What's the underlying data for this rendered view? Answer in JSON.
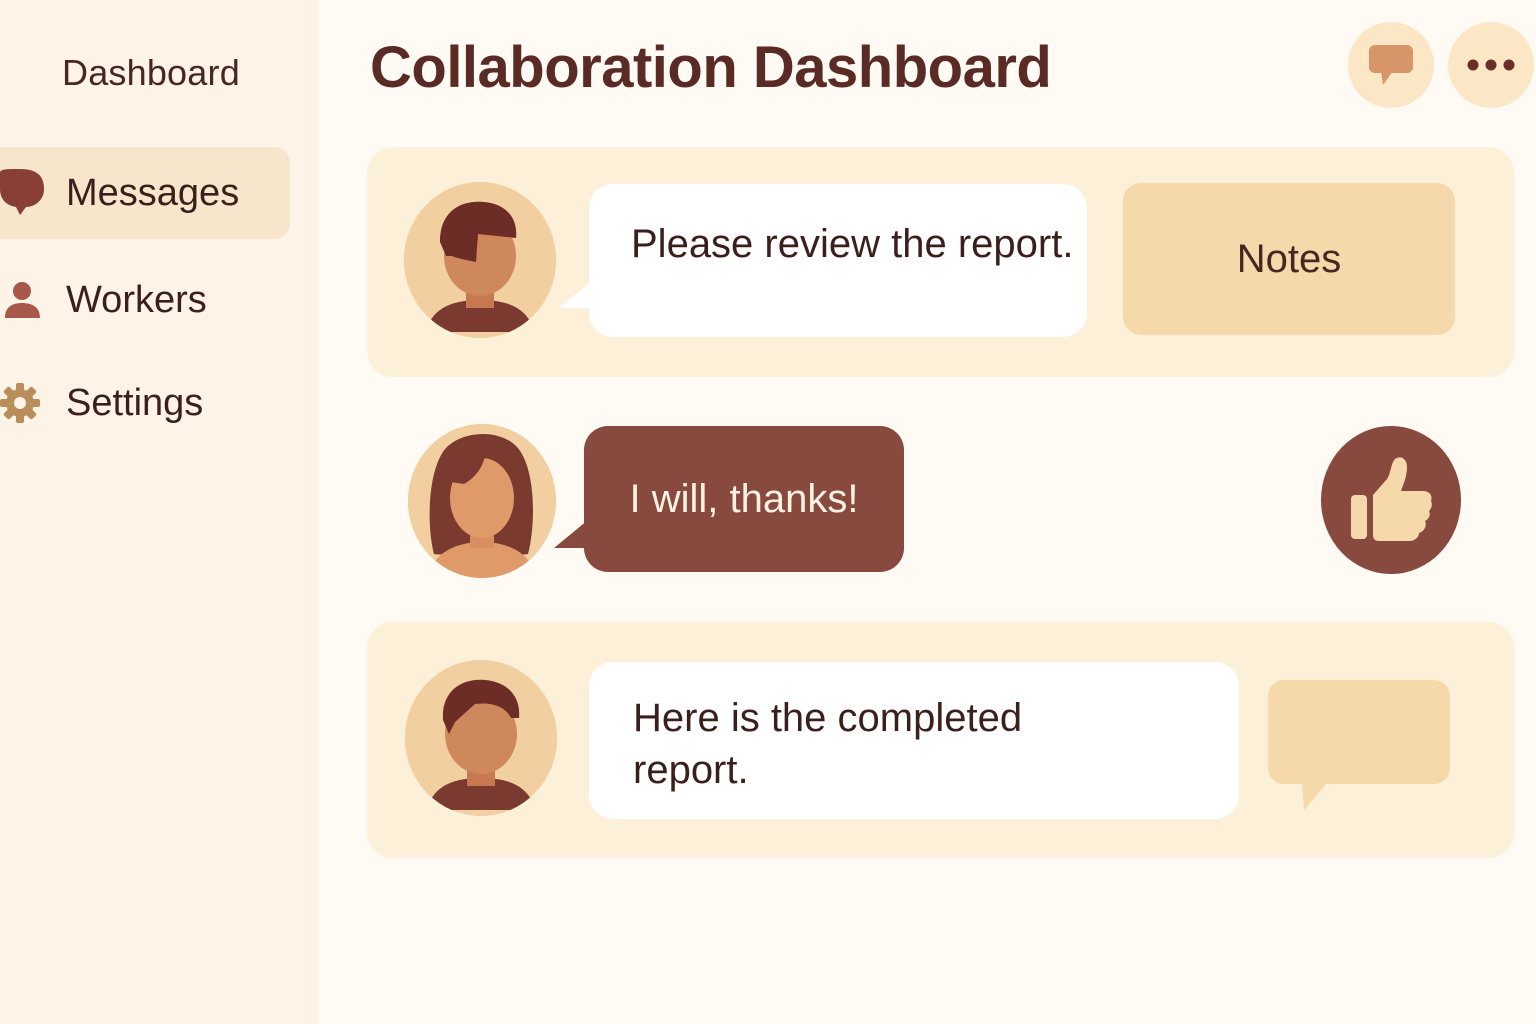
{
  "sidebar": {
    "title": "Dashboard",
    "items": [
      {
        "label": "Messages",
        "icon": "speech-bubble-icon",
        "active": true
      },
      {
        "label": "Workers",
        "icon": "person-icon",
        "active": false
      },
      {
        "label": "Settings",
        "icon": "gear-icon",
        "active": false
      }
    ]
  },
  "header": {
    "title": "Collaboration Dashboard",
    "chat_icon": "chat-bubble-icon",
    "more_icon": "more-horizontal-icon"
  },
  "messages": [
    {
      "sender": "man",
      "text": "Please review the report.",
      "action_label": "Notes"
    },
    {
      "sender": "woman",
      "text": "I will, thanks!",
      "action_icon": "thumbs-up-icon"
    },
    {
      "sender": "man",
      "text_line1": "Here is the completed",
      "text_line2": "report.",
      "action_icon": "reply-bubble-icon"
    }
  ],
  "colors": {
    "sidebar_bg": "#fdf3e6",
    "card_bg": "#fdf0d9",
    "accent_dark": "#884a3f",
    "accent_light": "#f6d9aa",
    "title_text": "#5a2a24"
  }
}
